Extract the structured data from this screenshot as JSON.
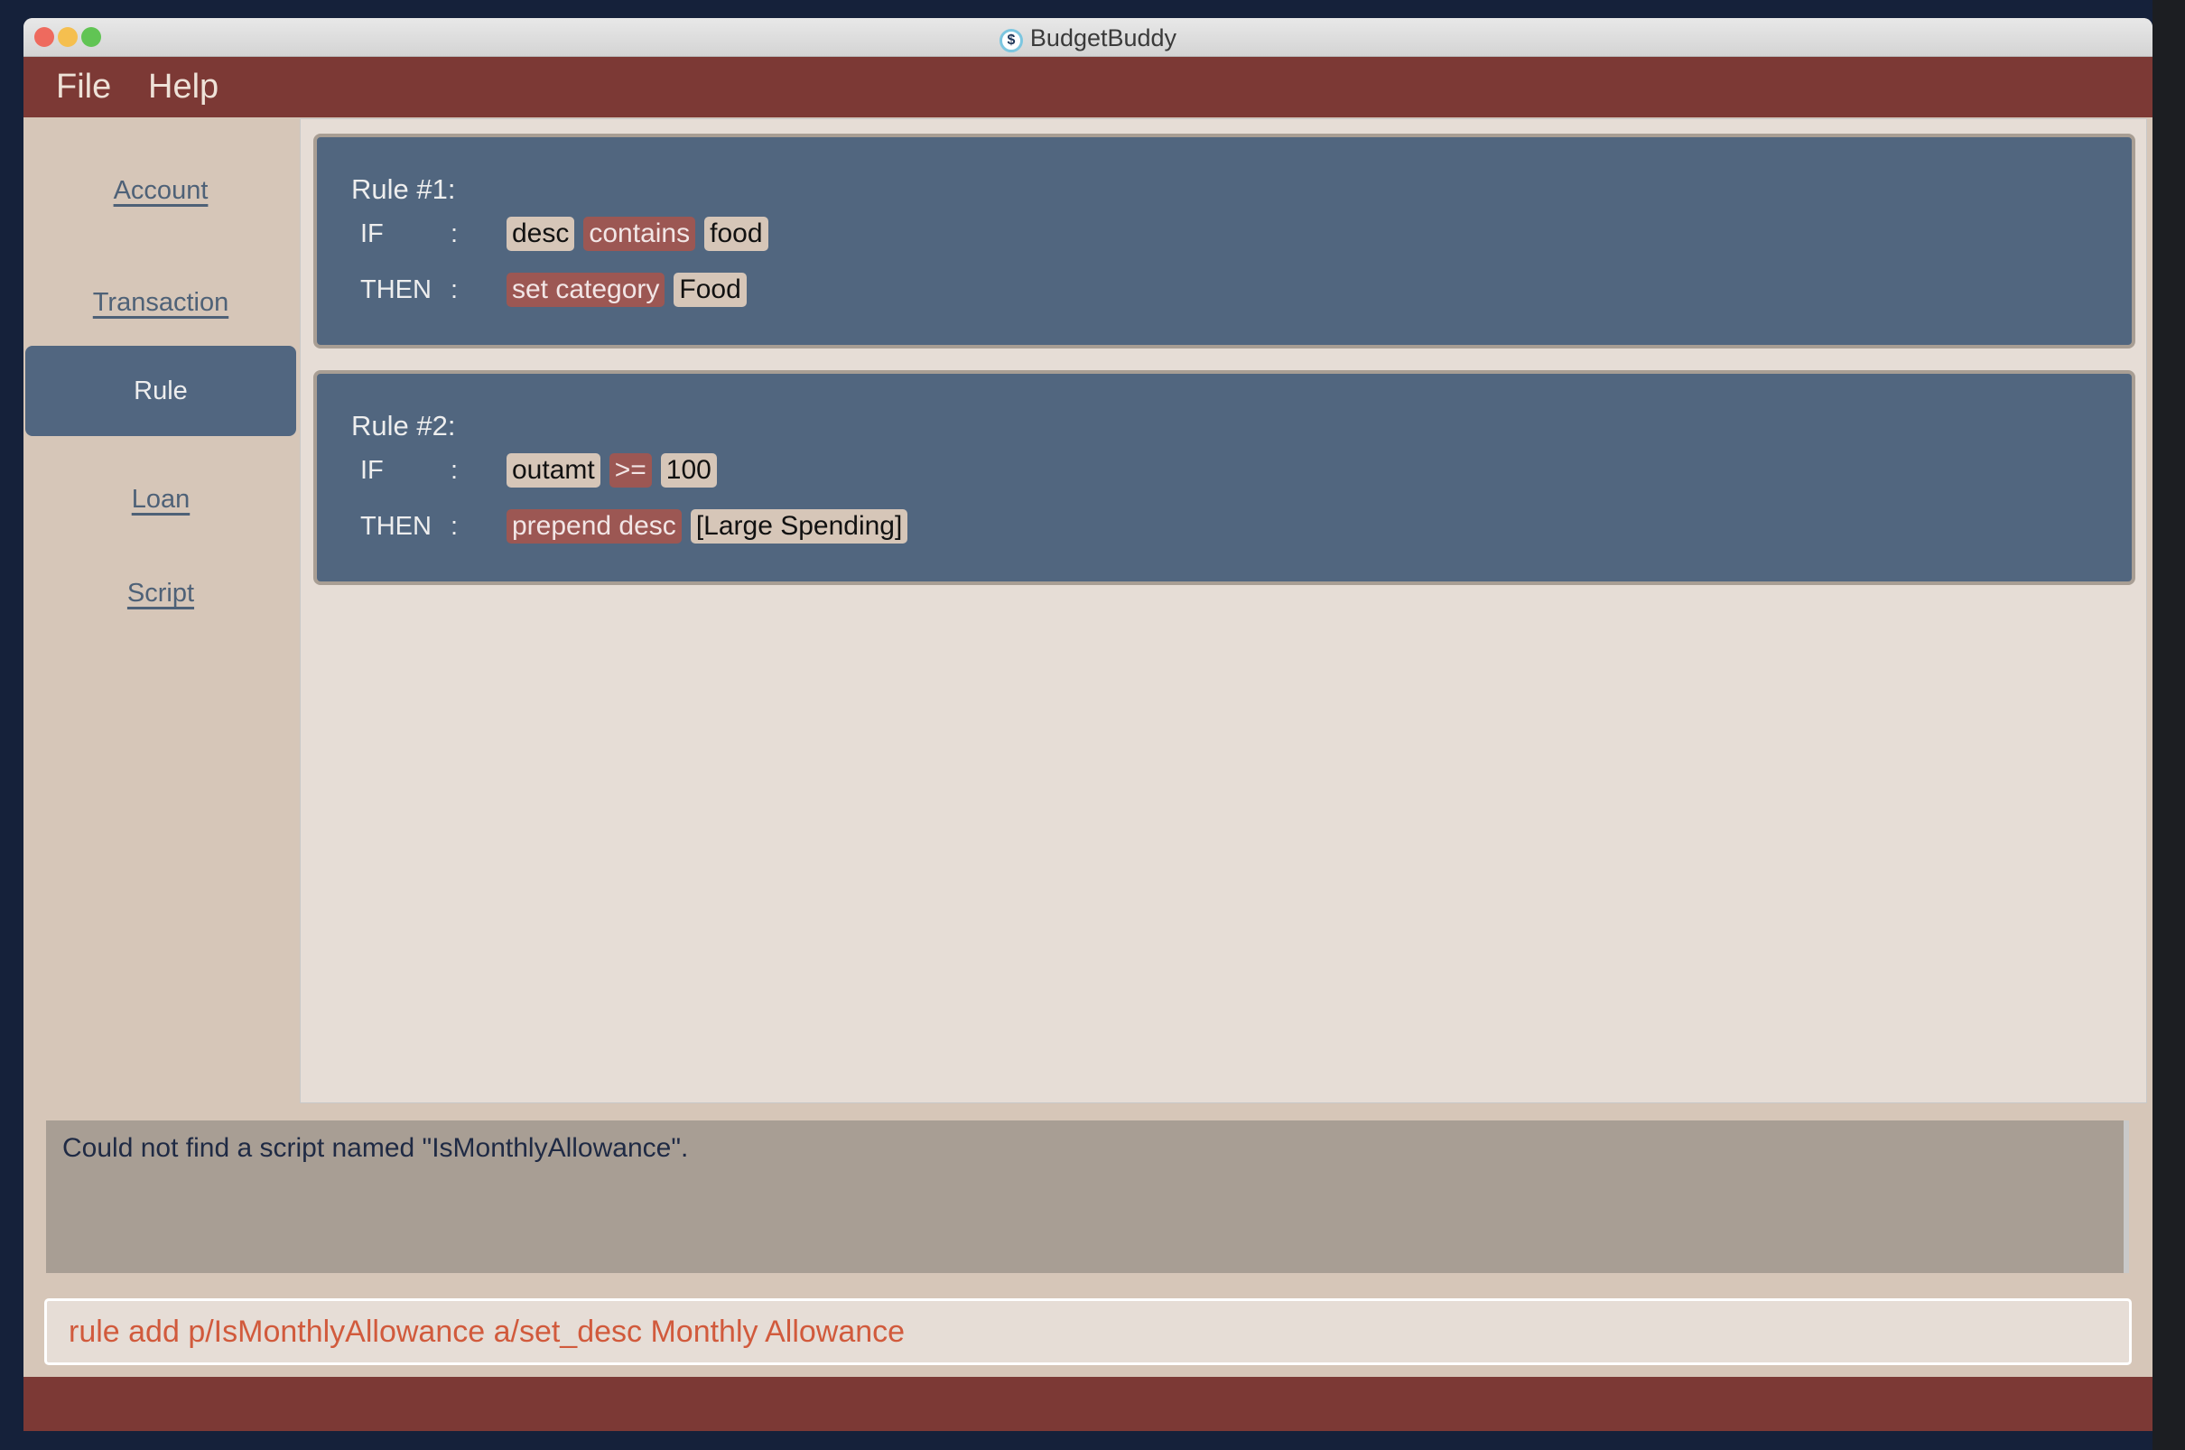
{
  "window": {
    "title": "BudgetBuddy",
    "app_icon": "dollar-coin-icon"
  },
  "menu": {
    "items": [
      "File",
      "Help"
    ]
  },
  "sidebar": {
    "items": [
      {
        "label": "Account"
      },
      {
        "label": "Transaction"
      },
      {
        "label": "Rule",
        "selected": true
      },
      {
        "label": "Loan"
      },
      {
        "label": "Script"
      }
    ]
  },
  "rules": [
    {
      "title": "Rule #1:",
      "if_label": "IF",
      "then_label": "THEN",
      "colon": ":",
      "if": [
        {
          "text": "desc",
          "kind": "attr"
        },
        {
          "text": "contains",
          "kind": "op"
        },
        {
          "text": "food",
          "kind": "value"
        }
      ],
      "then": [
        {
          "text": "set category",
          "kind": "op"
        },
        {
          "text": "Food",
          "kind": "value"
        }
      ]
    },
    {
      "title": "Rule #2:",
      "if_label": "IF",
      "then_label": "THEN",
      "colon": ":",
      "if": [
        {
          "text": "outamt",
          "kind": "attr"
        },
        {
          "text": ">=",
          "kind": "op"
        },
        {
          "text": "100",
          "kind": "value"
        }
      ],
      "then": [
        {
          "text": "prepend desc",
          "kind": "op"
        },
        {
          "text": "[Large Spending]",
          "kind": "value"
        }
      ]
    }
  ],
  "result": {
    "text": "Could not find a script named \"IsMonthlyAllowance\"."
  },
  "command": {
    "value": "rule add p/IsMonthlyAllowance a/set_desc Monthly Allowance"
  },
  "colors": {
    "menubar": "#7c3935",
    "accent": "#51667f",
    "sidebar": "#d6c6b8",
    "op_chip": "#9c5753",
    "command_text": "#d15a3c"
  }
}
